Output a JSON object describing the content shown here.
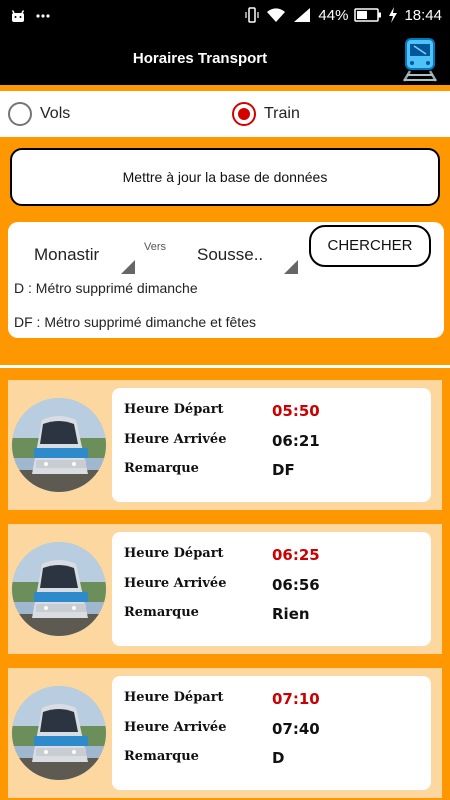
{
  "status_bar": {
    "battery": "44%",
    "time": "18:44",
    "icons": [
      "android-icon",
      "more-dots-icon",
      "vibrate-icon",
      "wifi-icon",
      "signal-icon",
      "battery-icon",
      "charging-icon"
    ]
  },
  "app_bar": {
    "title": "Horaires Transport",
    "icon": "train-icon"
  },
  "mode": {
    "options": [
      {
        "label": "Vols",
        "checked": false
      },
      {
        "label": "Train",
        "checked": true
      }
    ]
  },
  "update_button": {
    "label": "Mettre à jour la base de données"
  },
  "search": {
    "from": "Monastir",
    "vers_label": "Vers",
    "to": "Sousse..",
    "button_label": "CHERCHER",
    "notes": [
      "D : Métro supprimé dimanche",
      "DF : Métro supprimé dimanche et fêtes"
    ]
  },
  "colors": {
    "background": "#ff9800",
    "accent_red": "#d50000",
    "card_band": "#fcd7a0"
  },
  "labels": {
    "depart": "Heure Départ",
    "arrivee": "Heure Arrivée",
    "remarque": "Remarque"
  },
  "schedules": [
    {
      "depart": "05:50",
      "arrivee": "06:21",
      "remarque": "DF"
    },
    {
      "depart": "06:25",
      "arrivee": "06:56",
      "remarque": "Rien"
    },
    {
      "depart": "07:10",
      "arrivee": "07:40",
      "remarque": "D"
    }
  ]
}
